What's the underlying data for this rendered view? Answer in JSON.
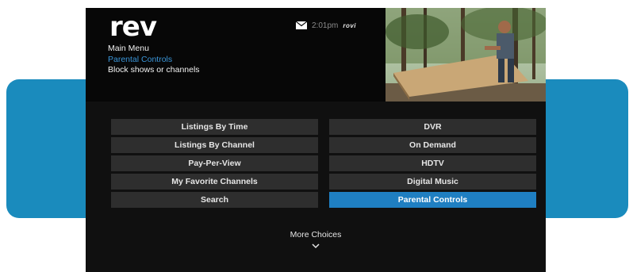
{
  "header": {
    "logo_text": "rev",
    "breadcrumb": {
      "main": "Main Menu",
      "current": "Parental Controls",
      "description": "Block shows or channels"
    },
    "status": {
      "time": "2:01pm",
      "brand": "rovi",
      "mail_icon": "mail-icon"
    }
  },
  "menu": {
    "left": [
      {
        "label": "Listings By Time",
        "selected": false
      },
      {
        "label": "Listings By Channel",
        "selected": false
      },
      {
        "label": "Pay-Per-View",
        "selected": false
      },
      {
        "label": "My Favorite Channels",
        "selected": false
      },
      {
        "label": "Search",
        "selected": false
      }
    ],
    "right": [
      {
        "label": "DVR",
        "selected": false
      },
      {
        "label": "On Demand",
        "selected": false
      },
      {
        "label": "HDTV",
        "selected": false
      },
      {
        "label": "Digital Music",
        "selected": false
      },
      {
        "label": "Parental Controls",
        "selected": true
      }
    ]
  },
  "footer": {
    "more_label": "More Choices",
    "chevron_icon": "chevron-down-icon"
  },
  "colors": {
    "accent": "#1f7fc2",
    "band": "#1a8bbd",
    "button_bg": "#2e2e2e",
    "screen_bg": "#101010"
  }
}
